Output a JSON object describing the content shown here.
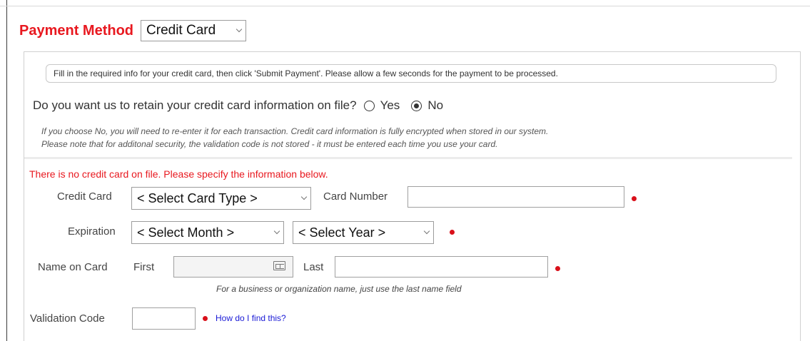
{
  "payment_method": {
    "label": "Payment Method",
    "selected": "Credit Card"
  },
  "info": {
    "text": "Fill in the required info for your credit card, then click 'Submit Payment'. Please allow a few seconds for the payment to be processed."
  },
  "retain": {
    "question": "Do you want us to retain your credit card information on file?",
    "options": [
      {
        "label": "Yes",
        "checked": false
      },
      {
        "label": "No",
        "checked": true
      }
    ],
    "note_line1": "If you choose No, you will need to re-enter it for each transaction. Credit card information is fully encrypted when stored in our system.",
    "note_line2": "Please note that for additonal security, the validation code is not stored - it must be entered each time you use your card."
  },
  "no_card_message": "There is no credit card on file. Please specify the information below.",
  "form": {
    "credit_card_label": "Credit Card",
    "card_type_selected": "< Select Card Type >",
    "card_number_label": "Card Number",
    "card_number_value": "",
    "expiration_label": "Expiration",
    "month_selected": "< Select Month >",
    "year_selected": "< Select Year >",
    "name_label": "Name on Card",
    "first_label": "First",
    "first_value": "",
    "last_label": "Last",
    "last_value": "",
    "name_hint": "For a business or organization name, just use the last name field",
    "validation_label": "Validation Code",
    "validation_value": "",
    "help_link": "How do I find this?"
  },
  "colors": {
    "accent_red": "#e8181f",
    "required_dot": "#d9101a",
    "link_blue": "#1a1ad6"
  },
  "icons": {
    "required": "red-dot-icon",
    "contact_card": "contact-card-icon",
    "dropdown": "chevron-down-icon"
  }
}
